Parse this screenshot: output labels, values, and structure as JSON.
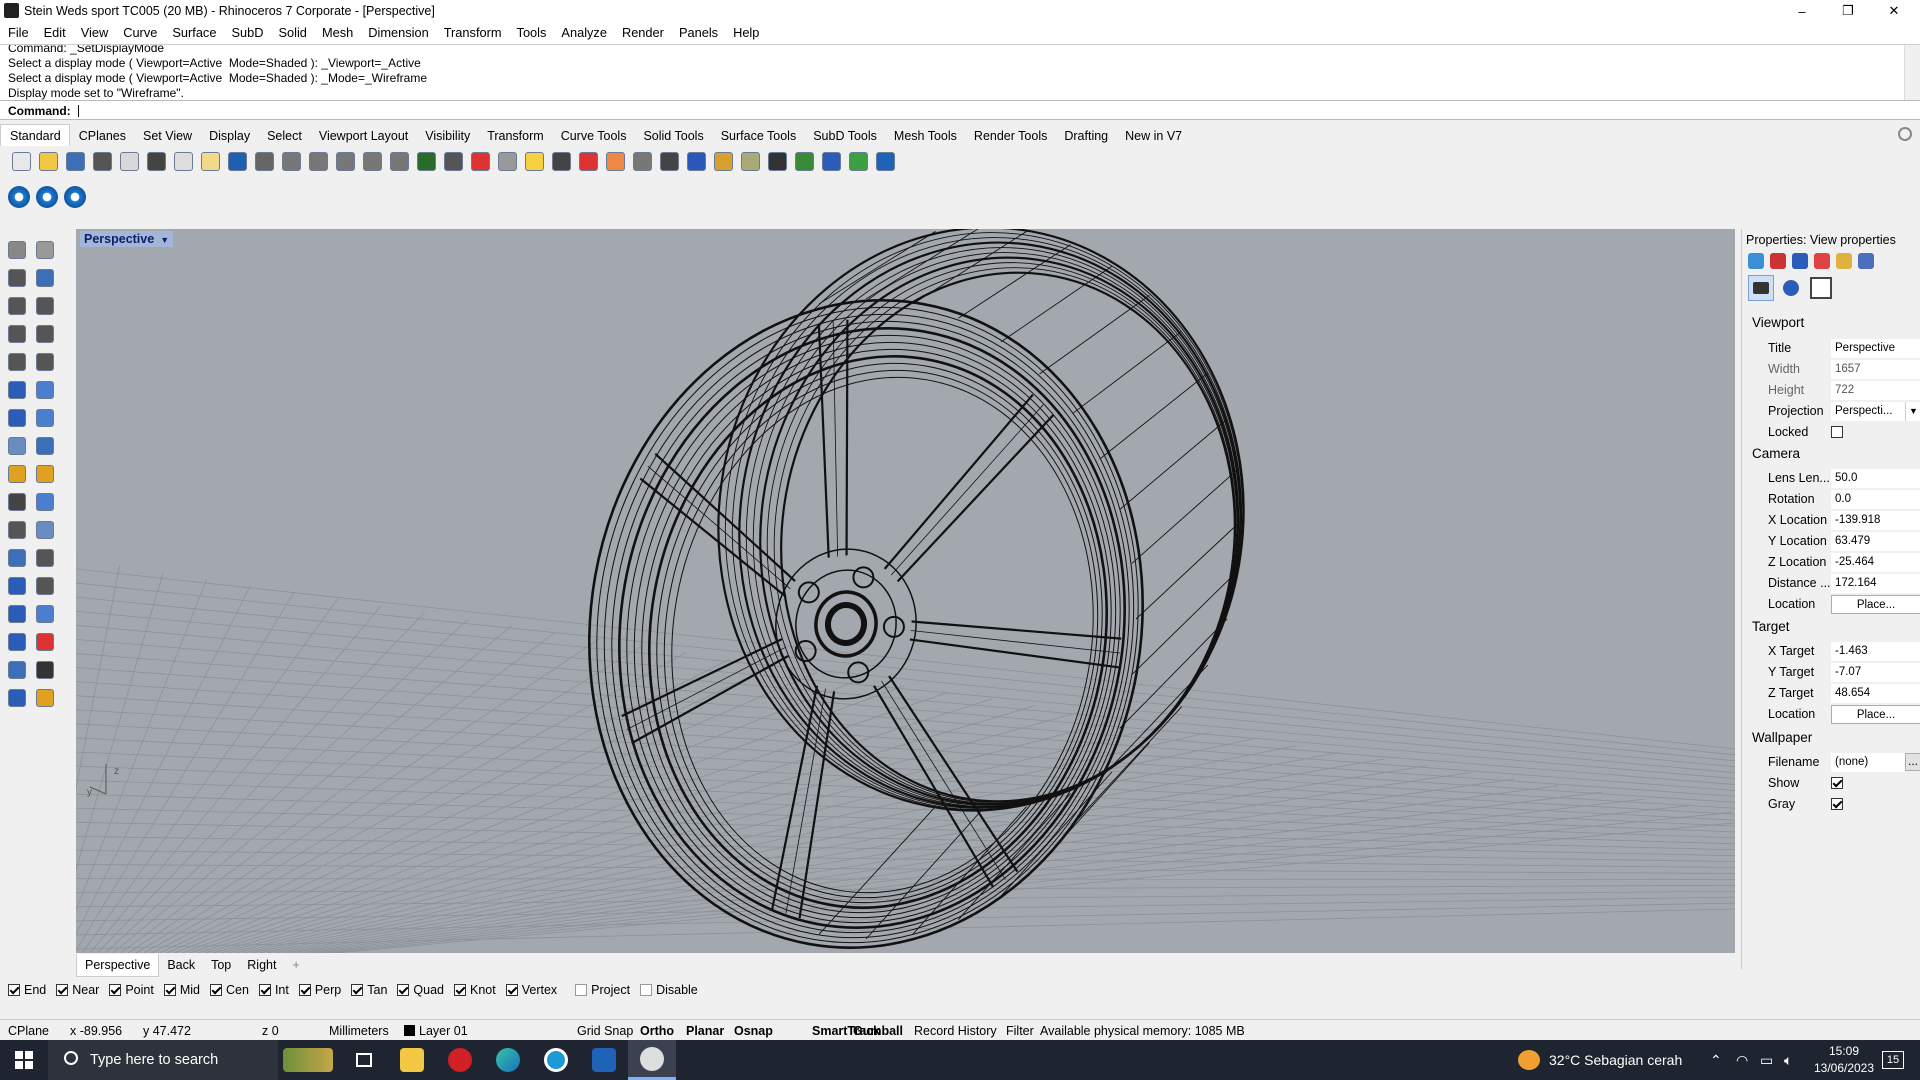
{
  "window": {
    "title": "Stein Weds sport TC005 (20 MB) - Rhinoceros 7 Corporate - [Perspective]",
    "minimize": "–",
    "maximize": "❐",
    "close": "✕"
  },
  "menu": [
    "File",
    "Edit",
    "View",
    "Curve",
    "Surface",
    "SubD",
    "Solid",
    "Mesh",
    "Dimension",
    "Transform",
    "Tools",
    "Analyze",
    "Render",
    "Panels",
    "Help"
  ],
  "command_history": [
    "Command: _SetDisplayMode",
    "Select a display mode ( Viewport=Active  Mode=Shaded ): _Viewport=_Active",
    "Select a display mode ( Viewport=Active  Mode=Shaded ): _Mode=_Wireframe",
    "Display mode set to \"Wireframe\"."
  ],
  "command_prompt": "Command:",
  "toolbar_tabs": [
    "Standard",
    "CPlanes",
    "Set View",
    "Display",
    "Select",
    "Viewport Layout",
    "Visibility",
    "Transform",
    "Curve Tools",
    "Solid Tools",
    "Surface Tools",
    "SubD Tools",
    "Mesh Tools",
    "Render Tools",
    "Drafting",
    "New in V7"
  ],
  "active_tab": "Standard",
  "toolbar_icons": [
    "new-icon",
    "open-icon",
    "save-icon",
    "print-icon",
    "import-icon",
    "cut-icon",
    "copy-icon",
    "paste-icon",
    "undo-icon",
    "pan-icon",
    "rotate-view-icon",
    "zoom-icon",
    "zoom-window-icon",
    "zoom-extents-icon",
    "zoom-selected-icon",
    "undo-view-icon",
    "four-viewports-icon",
    "cplane-icon",
    "grid-icon",
    "points-on-icon",
    "lock-icon",
    "layer-icon",
    "light-icon",
    "lock-object-icon",
    "color-icon",
    "render-sphere-icon",
    "material-sphere-icon",
    "environment-icon",
    "camera-icon",
    "settings-icon",
    "dimension-icon",
    "globe-icon",
    "help-icon"
  ],
  "toolbar2_icons": [
    "snapshot-icon-1",
    "snapshot-icon-2",
    "snapshot-icon-3"
  ],
  "viewport": {
    "label": "Perspective",
    "axis_x": "x",
    "axis_y": "y",
    "axis_z": "z"
  },
  "view_tabs": [
    "Perspective",
    "Back",
    "Top",
    "Right",
    "+"
  ],
  "active_view_tab": "Perspective",
  "osnaps": [
    {
      "label": "End",
      "on": true
    },
    {
      "label": "Near",
      "on": true
    },
    {
      "label": "Point",
      "on": true
    },
    {
      "label": "Mid",
      "on": true
    },
    {
      "label": "Cen",
      "on": true
    },
    {
      "label": "Int",
      "on": true
    },
    {
      "label": "Perp",
      "on": true
    },
    {
      "label": "Tan",
      "on": true
    },
    {
      "label": "Quad",
      "on": true
    },
    {
      "label": "Knot",
      "on": true
    },
    {
      "label": "Vertex",
      "on": true
    },
    {
      "label": "Project",
      "on": false
    },
    {
      "label": "Disable",
      "on": false
    }
  ],
  "status": {
    "cplane": "CPlane",
    "x": "x -89.956",
    "y": "y 47.472",
    "z": "z 0",
    "units": "Millimeters",
    "layer": "Layer 01",
    "grid_snap": "Grid Snap",
    "ortho": "Ortho",
    "planar": "Planar",
    "osnap": "Osnap",
    "smarttrack": "SmartTrack",
    "gumball": "Gumball",
    "record_history": "Record History",
    "filter": "Filter",
    "memory": "Available physical memory: 1085 MB"
  },
  "properties": {
    "header": "Properties: View properties",
    "viewport_section": "Viewport",
    "title_k": "Title",
    "title_v": "Perspective",
    "width_k": "Width",
    "width_v": "1657",
    "height_k": "Height",
    "height_v": "722",
    "projection_k": "Projection",
    "projection_v": "Perspecti...",
    "locked_k": "Locked",
    "camera_section": "Camera",
    "lens_k": "Lens Len...",
    "lens_v": "50.0",
    "rotation_k": "Rotation",
    "rotation_v": "0.0",
    "xloc_k": "X Location",
    "xloc_v": "-139.918",
    "yloc_k": "Y Location",
    "yloc_v": "63.479",
    "zloc_k": "Z Location",
    "zloc_v": "-25.464",
    "dist_k": "Distance ...",
    "dist_v": "172.164",
    "loc_k": "Location",
    "place_label": "Place...",
    "target_section": "Target",
    "xt_k": "X Target",
    "xt_v": "-1.463",
    "yt_k": "Y Target",
    "yt_v": "-7.07",
    "zt_k": "Z Target",
    "zt_v": "48.654",
    "tloc_k": "Location",
    "wallpaper_section": "Wallpaper",
    "file_k": "Filename",
    "file_v": "(none)",
    "browse": "...",
    "show_k": "Show",
    "gray_k": "Gray"
  },
  "taskbar": {
    "search_placeholder": "Type here to search",
    "weather": "32°C  Sebagian cerah",
    "time": "15:09",
    "date": "13/06/2023",
    "notifications": "15"
  }
}
